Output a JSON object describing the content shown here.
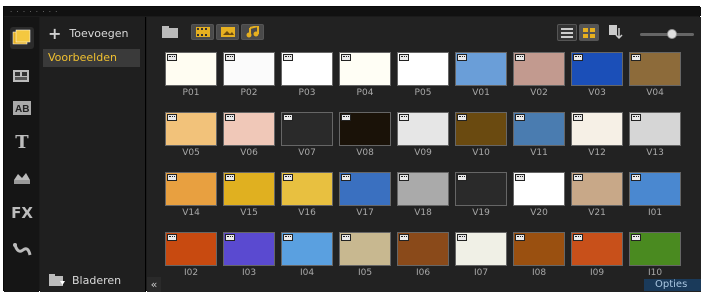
{
  "left_panel": {
    "add_label": "Toevoegen",
    "folder_label": "Voorbeelden",
    "browse_label": "Bladeren"
  },
  "collapse_glyph": "«",
  "opties_label": "Opties",
  "opties_glyph": "︽",
  "rail_icons": [
    "media-library-icon",
    "instant-project-icon",
    "transition-icon",
    "title-icon",
    "graphic-icon",
    "fx-icon",
    "motion-path-icon"
  ],
  "rail_labels": {
    "transition": "AB",
    "title": "T",
    "fx": "FX"
  },
  "media": {
    "rows": [
      [
        "P01",
        "P02",
        "P03",
        "P04",
        "P05",
        "V01",
        "V02",
        "V03",
        "V04"
      ],
      [
        "V05",
        "V06",
        "V07",
        "V08",
        "V09",
        "V10",
        "V11",
        "V12",
        "V13"
      ],
      [
        "V14",
        "V15",
        "V16",
        "V17",
        "V18",
        "V19",
        "V20",
        "V21",
        "I01"
      ],
      [
        "I02",
        "I03",
        "I04",
        "I05",
        "I06",
        "I07",
        "I08",
        "I09",
        "I10"
      ]
    ],
    "colors": [
      [
        "#fffdf2",
        "#fbfbfb",
        "#ffffff",
        "#fffef5",
        "#ffffff",
        "#6a9ed8",
        "#c29a8f",
        "#1b4fb8",
        "#8d6b3a"
      ],
      [
        "#f2c27a",
        "#f0c8b8",
        "#2a2a2a",
        "#1a1208",
        "#e6e6e6",
        "#6a4a10",
        "#4a7cb0",
        "#f6f0e6",
        "#d6d6d6"
      ],
      [
        "#e8a040",
        "#e0b020",
        "#e8c040",
        "#3a70c0",
        "#aaaaaa",
        "#2a2a2a",
        "#ffffff",
        "#c8a888",
        "#4a88d0"
      ],
      [
        "#c84a10",
        "#5a4ad0",
        "#5aa0e0",
        "#c8b890",
        "#8a4a1a",
        "#f0f0e6",
        "#9a5010",
        "#c8501a",
        "#4a8a20"
      ]
    ]
  }
}
